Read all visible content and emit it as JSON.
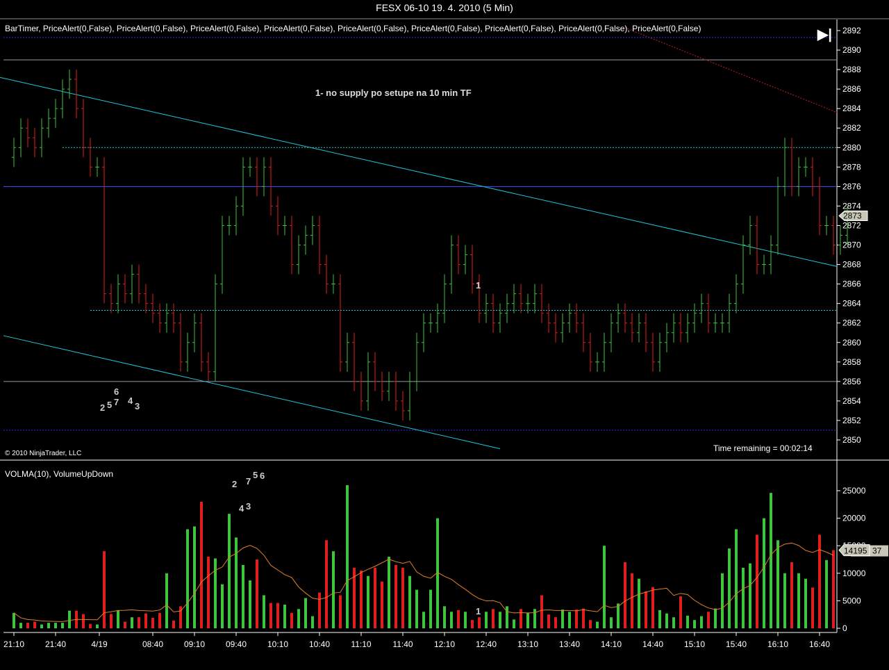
{
  "title": "FESX 06-10  19. 4. 2010 (5 Min)",
  "indicators_label": "BarTimer, PriceAlert(0,False), PriceAlert(0,False),  PriceAlert(0,False), PriceAlert(0,False), PriceAlert(0,False), PriceAlert(0,False),  PriceAlert(0,False), PriceAlert(0,False), PriceAlert(0,False)",
  "play_button": "▶|",
  "note": "1- no supply po setupe na 10 min TF",
  "copyright": "© 2010 NinjaTrader, LLC",
  "time_remaining": "Time remaining = 00:02:14",
  "volume_indicators_label": "VOLMA(10), VolumeUpDown",
  "markers": {
    "price_a": "2",
    "price_b": "5",
    "price_c": "7",
    "price_d": "6",
    "price_e": "4",
    "price_f": "3",
    "price_one": "1",
    "vol_a": "2",
    "vol_b": "7",
    "vol_c": "5",
    "vol_d": "6",
    "vol_e": "4",
    "vol_f": "3",
    "vol_one": "1"
  },
  "colors": {
    "up": "#3ec43e",
    "down": "#e01e1e",
    "trend": "#1fc8d8",
    "level": "#2a2aff",
    "sma": "#e0802a"
  },
  "chart_data": [
    {
      "type": "ohlc",
      "title": "FESX 06-10 5 Min",
      "ylim": [
        2849,
        2893
      ],
      "yticks": [
        2850,
        2852,
        2854,
        2856,
        2858,
        2860,
        2862,
        2864,
        2866,
        2868,
        2870,
        2872,
        2874,
        2876,
        2878,
        2880,
        2882,
        2884,
        2886,
        2888,
        2890,
        2892
      ],
      "last_price": "2873",
      "close": [
        2880,
        2882,
        2881,
        2880,
        2882,
        2883,
        2884,
        2886,
        2887,
        2884,
        2880,
        2878,
        2878,
        2865,
        2864,
        2866,
        2865,
        2867,
        2865,
        2864,
        2863,
        2862,
        2863,
        2862,
        2858,
        2860,
        2862,
        2858,
        2857,
        2866,
        2872,
        2872,
        2874,
        2878,
        2878,
        2876,
        2878,
        2874,
        2872,
        2872,
        2868,
        2870,
        2871,
        2872,
        2868,
        2866,
        2866,
        2858,
        2860,
        2856,
        2854,
        2858,
        2856,
        2855,
        2856,
        2854,
        2853,
        2856,
        2860,
        2862,
        2862,
        2863,
        2866,
        2870,
        2868,
        2869,
        2866,
        2863,
        2864,
        2862,
        2863,
        2864,
        2865,
        2864,
        2864,
        2865,
        2863,
        2862,
        2861,
        2862,
        2863,
        2862,
        2860,
        2858,
        2858,
        2860,
        2862,
        2863,
        2862,
        2861,
        2862,
        2860,
        2858,
        2860,
        2861,
        2862,
        2861,
        2862,
        2863,
        2864,
        2862,
        2862,
        2862,
        2864,
        2866,
        2870,
        2872,
        2868,
        2868,
        2870,
        2876,
        2880,
        2876,
        2878,
        2878,
        2876,
        2872,
        2872,
        2870,
        2871,
        2873
      ],
      "lines": [
        {
          "kind": "hline",
          "price": 2889,
          "color": "#999"
        },
        {
          "kind": "hline",
          "price": 2856,
          "color": "#999"
        },
        {
          "kind": "hline",
          "price": 2876,
          "color": "#4a4aff"
        },
        {
          "kind": "dotted",
          "price": 2891.3,
          "color": "#2a2aff"
        },
        {
          "kind": "dotted",
          "price": 2851,
          "color": "#2a2aff"
        },
        {
          "kind": "dotted",
          "price": 2880,
          "from_bar": 7,
          "color": "#1fc8d8"
        },
        {
          "kind": "dotted",
          "price": 2863.3,
          "from_bar": 11,
          "color": "#1fc8d8"
        }
      ],
      "trendlines": [
        {
          "p1": [
            -2,
            2887.2
          ],
          "p2": [
            118.5,
            2867.8
          ],
          "color": "#1fc8d8"
        },
        {
          "p1": [
            -1.5,
            2860.7
          ],
          "p2": [
            70,
            2849.1
          ],
          "color": "#1fc8d8"
        },
        {
          "p1": [
            88,
            2892.3
          ],
          "p2": [
            118.5,
            2883.6
          ],
          "color": "#c0202a",
          "dash": true
        }
      ]
    },
    {
      "type": "bar",
      "ylim": [
        0,
        25000
      ],
      "yticks": [
        0,
        5000,
        10000,
        15000,
        20000,
        25000
      ],
      "last_volume": "14195",
      "last_sma_suffix": "37",
      "volume": [
        2800,
        1000,
        1000,
        1200,
        700,
        1000,
        1000,
        1000,
        3200,
        3200,
        2600,
        800,
        700,
        14000,
        2600,
        3300,
        1200,
        2000,
        2000,
        2700,
        1900,
        2800,
        10000,
        1400,
        4000,
        18000,
        18500,
        23000,
        13000,
        12700,
        8000,
        20800,
        16500,
        11500,
        8700,
        12500,
        6000,
        4600,
        4600,
        4300,
        2800,
        3500,
        5500,
        2200,
        6500,
        16000,
        14000,
        6000,
        26000,
        11000,
        10500,
        9500,
        11000,
        8500,
        13000,
        11500,
        11000,
        9500,
        7000,
        3000,
        7000,
        20000,
        4000,
        3000,
        3300,
        3000,
        1500,
        2000,
        3000,
        3500,
        3000,
        4000,
        1600,
        3500,
        2800,
        3500,
        6000,
        2500,
        2000,
        3400,
        3000,
        3400,
        3600,
        1500,
        1200,
        15000,
        2000,
        4500,
        12000,
        10000,
        9000,
        6700,
        7500,
        3300,
        2700,
        2000,
        5800,
        2300,
        1500,
        2200,
        3000,
        3600,
        10000,
        14500,
        18000,
        11000,
        11800,
        17000,
        20000,
        24600,
        16000,
        10000,
        12000,
        10000,
        9000,
        7400,
        17000,
        12400,
        14195
      ]
    },
    {
      "type": "axis",
      "xticks": [
        {
          "bar": 0,
          "label": "21:10"
        },
        {
          "bar": 6,
          "label": "21:40"
        },
        {
          "bar": 12.3,
          "label": "4/19"
        },
        {
          "bar": 20,
          "label": "08:40"
        },
        {
          "bar": 26,
          "label": "09:10"
        },
        {
          "bar": 32,
          "label": "09:40"
        },
        {
          "bar": 38,
          "label": "10:10"
        },
        {
          "bar": 44,
          "label": "10:40"
        },
        {
          "bar": 50,
          "label": "11:10"
        },
        {
          "bar": 56,
          "label": "11:40"
        },
        {
          "bar": 62,
          "label": "12:10"
        },
        {
          "bar": 68,
          "label": "12:40"
        },
        {
          "bar": 74,
          "label": "13:10"
        },
        {
          "bar": 80,
          "label": "13:40"
        },
        {
          "bar": 86,
          "label": "14:10"
        },
        {
          "bar": 92,
          "label": "14:40"
        },
        {
          "bar": 98,
          "label": "15:10"
        },
        {
          "bar": 104,
          "label": "15:40"
        },
        {
          "bar": 110,
          "label": "16:10"
        },
        {
          "bar": 116,
          "label": "16:40"
        }
      ]
    }
  ]
}
